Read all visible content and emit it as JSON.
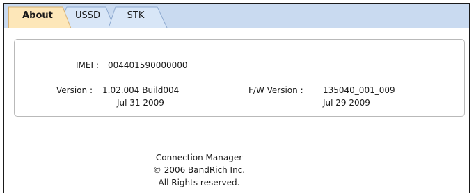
{
  "tabs": [
    {
      "label": "About",
      "active": true
    },
    {
      "label": "USSD",
      "active": false
    },
    {
      "label": "STK",
      "active": false
    }
  ],
  "colors": {
    "tab_active": "#fde7b9",
    "tab_inactive": "#d8e6f7",
    "tabbar_bg": "#c9daf0",
    "panel_border": "#b9b9b9"
  },
  "device_info": {
    "imei_label": "IMEI :",
    "imei_value": "004401590000000",
    "version_label": "Version :",
    "version_value": "1.02.004 Build004",
    "version_date": "Jul 31 2009",
    "fw_label": "F/W Version :",
    "fw_value": "135040_001_009",
    "fw_date": "Jul 29 2009"
  },
  "footer": {
    "product": "Connection Manager",
    "copyright": "© 2006 BandRich Inc.",
    "rights": "All Rights reserved."
  }
}
